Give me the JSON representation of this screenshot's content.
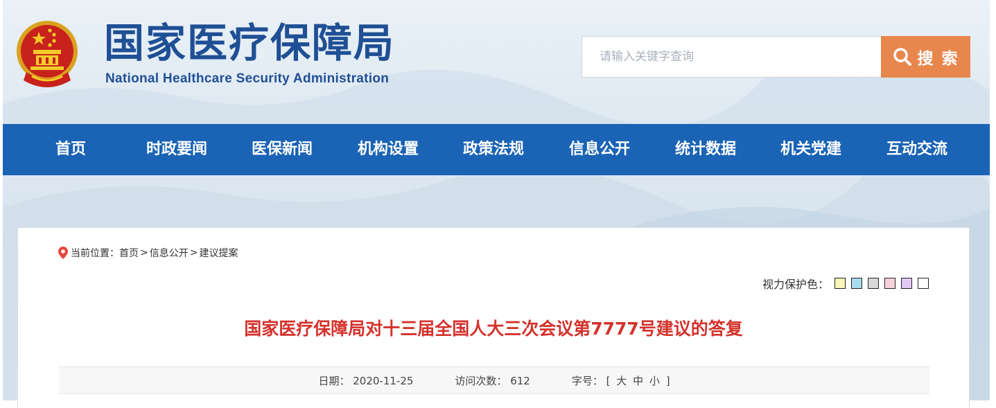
{
  "header": {
    "logo_cn": "国家医疗保障局",
    "logo_en": "National Healthcare Security Administration",
    "search_placeholder": "请输入关键字查询",
    "search_button": "搜 索"
  },
  "nav": {
    "items": [
      "首页",
      "时政要闻",
      "医保新闻",
      "机构设置",
      "政策法规",
      "信息公开",
      "统计数据",
      "机关党建",
      "互动交流"
    ]
  },
  "breadcrumb": {
    "prefix": "当前位置：",
    "items": [
      "首页",
      "信息公开",
      "建议提案"
    ],
    "separator": ">"
  },
  "eye_protection": {
    "label": "视力保护色：",
    "colors": [
      "#faf5b8",
      "#a8dcef",
      "#d8d8d8",
      "#f8d2db",
      "#e1c9f1",
      "#ffffff"
    ]
  },
  "article": {
    "title": "国家医疗保障局对十三届全国人大三次会议第7777号建议的答复",
    "date_label": "日期：",
    "date": "2020-11-25",
    "visits_label": "访问次数：",
    "visits": "612",
    "font_label": "字号：",
    "font_open": "[",
    "font_large": "大",
    "font_medium": "中",
    "font_small": "小",
    "font_close": "]"
  },
  "colors": {
    "nav_bg": "#1a63b5",
    "search_btn": "#e8874d",
    "title": "#d4322c",
    "logo": "#1f4f95"
  }
}
